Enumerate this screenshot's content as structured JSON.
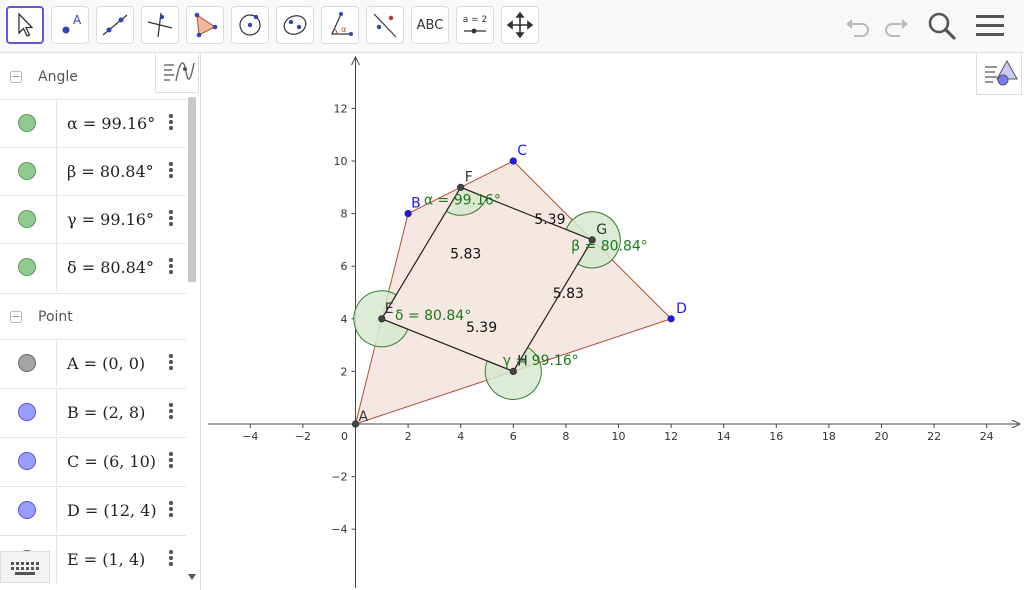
{
  "toolbar": {
    "tools": [
      {
        "name": "move-tool"
      },
      {
        "name": "point-tool"
      },
      {
        "name": "line-tool"
      },
      {
        "name": "perpendicular-line-tool"
      },
      {
        "name": "polygon-tool"
      },
      {
        "name": "circle-tool"
      },
      {
        "name": "ellipse-tool"
      },
      {
        "name": "angle-tool"
      },
      {
        "name": "reflect-tool"
      },
      {
        "name": "text-tool",
        "label": "ABC"
      },
      {
        "name": "slider-tool",
        "label": "a = 2"
      },
      {
        "name": "move-graphics-view-tool"
      }
    ],
    "right_icons": [
      "undo-icon",
      "redo-icon",
      "search-icon",
      "menu-icon"
    ]
  },
  "algebra": {
    "groups": [
      {
        "label": "Angle",
        "items": [
          {
            "def": "α = 99.16°",
            "color": "#8fc98f",
            "border": "#5c9a5c"
          },
          {
            "def": "β = 80.84°",
            "color": "#8fc98f",
            "border": "#5c9a5c"
          },
          {
            "def": "γ = 99.16°",
            "color": "#8fc98f",
            "border": "#5c9a5c"
          },
          {
            "def": "δ = 80.84°",
            "color": "#8fc98f",
            "border": "#5c9a5c"
          }
        ]
      },
      {
        "label": "Point",
        "items": [
          {
            "def": "A = (0, 0)",
            "color": "#a3a3a3",
            "border": "#6b6b6b"
          },
          {
            "def": "B = (2, 8)",
            "color": "#9c9cff",
            "border": "#5555dd"
          },
          {
            "def": "C = (6, 10)",
            "color": "#9c9cff",
            "border": "#5555dd"
          },
          {
            "def": "D = (12, 4)",
            "color": "#9c9cff",
            "border": "#5555dd"
          },
          {
            "def": "E = (1, 4)",
            "color": "#a3a3a3",
            "border": "#6b6b6b"
          }
        ]
      }
    ]
  },
  "graphics": {
    "x_ticks": [
      "−4",
      "−2",
      "0",
      "2",
      "4",
      "6",
      "8",
      "10",
      "12",
      "14",
      "16",
      "18",
      "20",
      "22",
      "24"
    ],
    "y_ticks": [
      "12",
      "10",
      "8",
      "6",
      "4",
      "2",
      "−2",
      "−4"
    ],
    "points": [
      {
        "label": "A",
        "x": 0,
        "y": 0,
        "color": "#444"
      },
      {
        "label": "B",
        "x": 2,
        "y": 8,
        "color": "#1a1aff"
      },
      {
        "label": "C",
        "x": 6,
        "y": 10,
        "color": "#1a1aff"
      },
      {
        "label": "D",
        "x": 12,
        "y": 4,
        "color": "#1a1aff"
      },
      {
        "label": "E",
        "x": 1,
        "y": 4,
        "color": "#444"
      },
      {
        "label": "F",
        "x": 4,
        "y": 9,
        "color": "#444"
      },
      {
        "label": "G",
        "x": 9,
        "y": 7,
        "color": "#444"
      },
      {
        "label": "H",
        "x": 6,
        "y": 2,
        "color": "#444"
      }
    ],
    "segment_labels": [
      "5.39",
      "5.83",
      "5.83",
      "5.39"
    ],
    "angle_labels": [
      "α = 99.16°",
      "β = 80.84°",
      "γ = 99.16°",
      "δ = 80.84°"
    ],
    "colors": {
      "polygon_fill": "#f3e2dc",
      "polygon_stroke": "#b24a2e",
      "angle_fill": "#d8e8d0",
      "angle_stroke": "#2e7d2e",
      "angle_text": "#1a7a1a"
    }
  }
}
